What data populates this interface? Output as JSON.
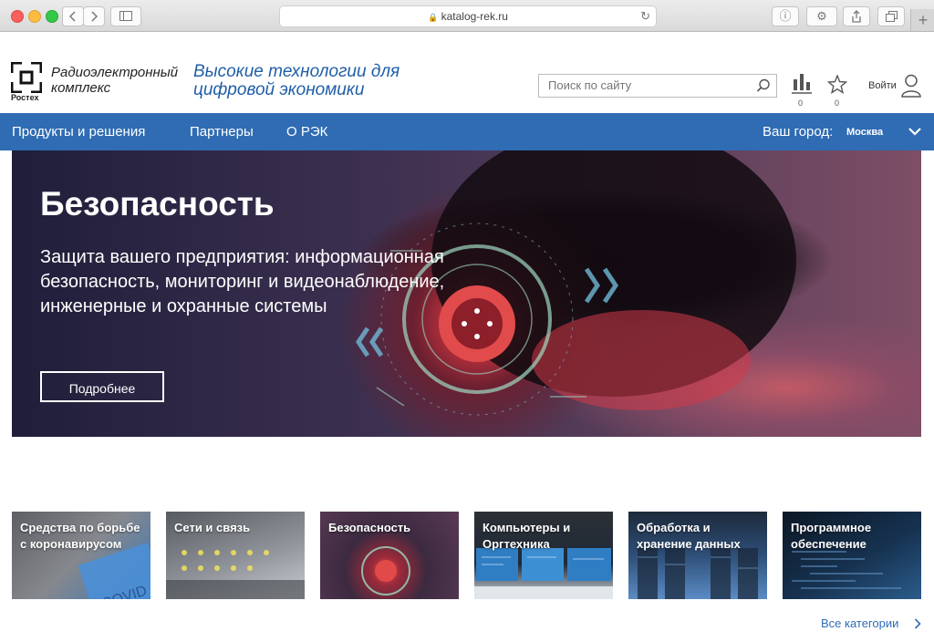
{
  "browser": {
    "url": "katalog-rek.ru",
    "back_icon": "chevron-left-icon",
    "forward_icon": "chevron-right-icon"
  },
  "header": {
    "logo_caption": "Ростех",
    "logo_text": "Радиоэлектронный комплекс",
    "slogan": "Высокие технологии для цифровой экономики",
    "search_placeholder": "Поиск по сайту",
    "compare_count": "0",
    "favorites_count": "0",
    "login_label": "Войти"
  },
  "nav": {
    "items": [
      "Продукты и решения",
      "Партнеры",
      "О РЭК"
    ],
    "city_label": "Ваш город:",
    "city_value": "Москва"
  },
  "hero": {
    "title": "Безопасность",
    "subtitle": "Защита вашего предприятия: информационная безопасность, мониторинг и видеонаблюдение, инженерные и охранные системы",
    "button": "Подробнее"
  },
  "categories": [
    "Средства по борьбе с коронавирусом",
    "Сети и связь",
    "Безопасность",
    "Компьютеры и Оргтехника",
    "Обработка и хранение данных",
    "Программное обеспечение"
  ],
  "categories_decor_text": "COVID",
  "all_categories": "Все категории",
  "colors": {
    "brand_blue": "#2f6cb3",
    "slogan_blue": "#1f5ea8"
  }
}
